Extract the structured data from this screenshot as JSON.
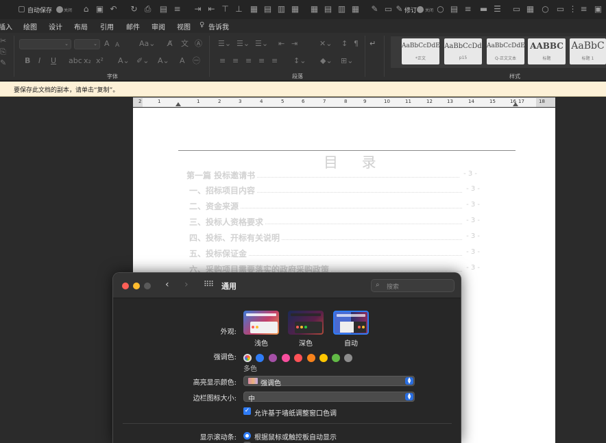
{
  "qat": {
    "autosave_label": "自动保存",
    "autosave_state": "关闭",
    "track_label": "修订",
    "track_state": "关闭"
  },
  "tabs": [
    "插入",
    "绘图",
    "设计",
    "布局",
    "引用",
    "邮件",
    "审阅",
    "视图"
  ],
  "tell_me": "告诉我",
  "ribbon": {
    "font_group": "字体",
    "para_group": "段落",
    "style_group": "样式",
    "styles": [
      {
        "preview": "AaBbCcDdEe",
        "name": "*正文"
      },
      {
        "preview": "AaBbCcDd",
        "name": "p15"
      },
      {
        "preview": "AaBbCcDdEe",
        "name": "Q-正文文本"
      },
      {
        "preview": "AABBC",
        "name": "标题"
      },
      {
        "preview": "AaBbC",
        "name": "标题 1"
      }
    ]
  },
  "message_bar": "要保存此文档的副本，请单击“复制”。",
  "ruler": {
    "numbers": [
      "2",
      "1",
      "1",
      "2",
      "3",
      "4",
      "5",
      "6",
      "7",
      "8",
      "9",
      "10",
      "11",
      "12",
      "13",
      "14",
      "15",
      "16",
      "17",
      "18"
    ]
  },
  "document": {
    "toc_title": "目 录",
    "toc": [
      {
        "text": "第一篇 投标邀请书",
        "page": "- 3 -",
        "level": 1
      },
      {
        "text": "一、招标项目内容",
        "page": "- 3 -",
        "level": 2
      },
      {
        "text": "二、资金来源",
        "page": "- 3 -",
        "level": 2
      },
      {
        "text": "三、投标人资格要求",
        "page": "- 3 -",
        "level": 2
      },
      {
        "text": "四、投标、开标有关说明",
        "page": "- 3 -",
        "level": 2
      },
      {
        "text": "五、投标保证金",
        "page": "- 3 -",
        "level": 2
      },
      {
        "text": "六、采购项目需要落实的政府采购政策",
        "page": "- 3 -",
        "level": 2
      }
    ]
  },
  "prefs": {
    "title": "通用",
    "search_placeholder": "搜索",
    "appearance_label": "外观:",
    "appearance_options": [
      "浅色",
      "深色",
      "自动"
    ],
    "accent_label": "强调色:",
    "accent_selected": "多色",
    "accent_colors": [
      "#2f7cf6",
      "#a550a7",
      "#f74f9e",
      "#ff5257",
      "#f7821b",
      "#ffc600",
      "#62ba46",
      "#8c8c8c"
    ],
    "highlight_label": "高亮显示颜色:",
    "highlight_value": "强调色",
    "sidebar_label": "边栏图标大小:",
    "sidebar_value": "中",
    "wallpaper_tint": "允许基于墙纸调整窗口色调",
    "scrollbars_label": "显示滚动条:",
    "scrollbars_value": "根据鼠标或触控板自动显示"
  }
}
